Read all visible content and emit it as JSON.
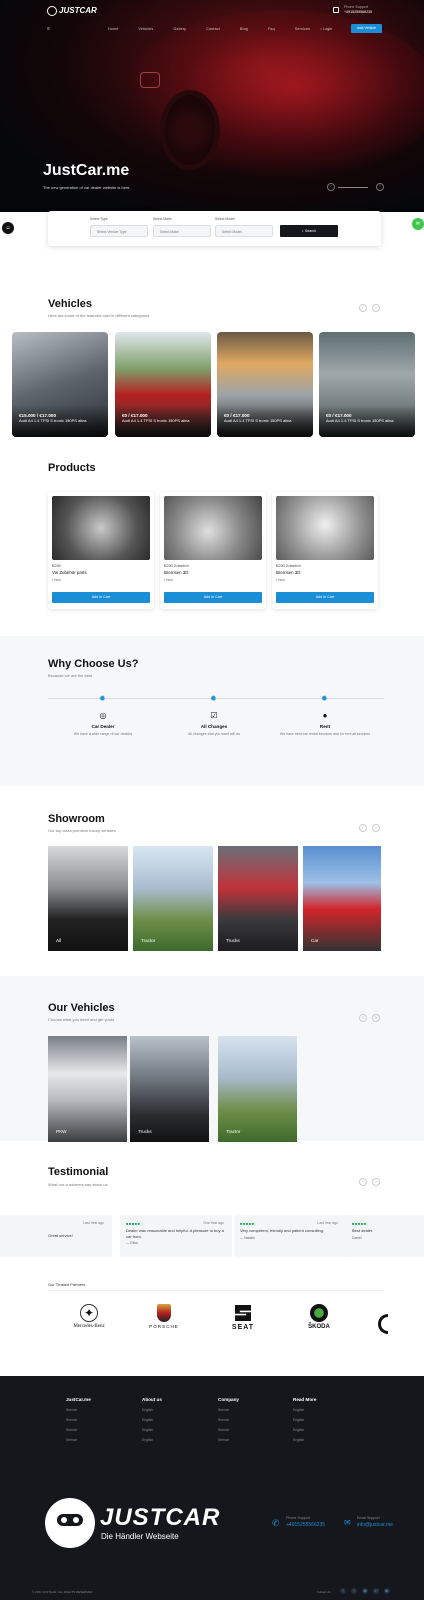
{
  "header": {
    "brand": "JUSTCAR",
    "phone_label": "Phone Support",
    "phone": "+4915255566235",
    "nav": [
      "Home",
      "Vehicles",
      "Gallery",
      "Contact",
      "Blog",
      "Faq",
      "Services"
    ],
    "login": "Login",
    "cta": "Add Vehicle"
  },
  "hero": {
    "title": "JustCar.me",
    "subtitle": "The new generation of car dealer website is here."
  },
  "search": {
    "f1_label": "Select Type",
    "f1": "Select Vehicle Type",
    "f2_label": "Select Make",
    "f2": "Select Make",
    "f3_label": "Select Model",
    "f3": "Select Model",
    "button": "Search"
  },
  "vehicles": {
    "title": "Vehicles",
    "subtitle": "Here are some of the featured cars in different categories",
    "items": [
      {
        "price": "€15.000 / €17.000",
        "name": "Audi A4 1.4 TFSI S tronic 150PS alina"
      },
      {
        "price": "€0 / €17.000",
        "name": "Audi A4 1.4 TFSI S tronic 150PS alina"
      },
      {
        "price": "€0 / €17.000",
        "name": "Audi A4 1.4 TFSI S tronic 150PS alina"
      },
      {
        "price": "€0 / €17.000",
        "name": "Audi A4 1.4 TFSI S tronic 150PS alina"
      }
    ]
  },
  "products": {
    "title": "Products",
    "items": [
      {
        "price": "€250",
        "name": "Vw Zubehör parts",
        "stock": "Neu",
        "button": "Add to Cart"
      },
      {
        "price": "€250 Zubehör",
        "name": "Bremsen 3D",
        "stock": "Neu",
        "button": "Add to Cart"
      },
      {
        "price": "€250 Zubehör",
        "name": "Bremsen 3D",
        "stock": "Neu",
        "button": "Add to Cart"
      }
    ]
  },
  "why": {
    "title": "Why Choose Us?",
    "subtitle": "Because we are the best",
    "features": [
      {
        "title": "Car Dealer",
        "desc": "We have a wide range of car dealers"
      },
      {
        "title": "All Changes",
        "desc": "All changes that you want will do"
      },
      {
        "title": "Rent",
        "desc": "We have best car rental services and for rent all services"
      }
    ]
  },
  "showroom": {
    "title": "Showroom",
    "subtitle": "Our top class premium luxury vehicles",
    "items": [
      "All",
      "Tractor",
      "Trucks",
      "Car"
    ]
  },
  "our_vehicles": {
    "title": "Our Vehicles",
    "subtitle": "Choose what you need and get yours",
    "items": [
      "PKW",
      "Trucks",
      "Tractor"
    ]
  },
  "testimonial": {
    "title": "Testimonial",
    "subtitle": "What our customers say about us",
    "items": [
      {
        "date": "Last Year ago",
        "quote": "Great service!",
        "author": ""
      },
      {
        "date": "One Year ago",
        "quote": "Dealer was reasonable and helpful. A pleasure to buy a car from.",
        "author": "Elisa"
      },
      {
        "date": "Last Year ago",
        "quote": "Very competent, friendly and patient consulting.",
        "author": "Natalie"
      },
      {
        "date": "",
        "quote": "Best dealer.",
        "author": "Daniel"
      }
    ]
  },
  "partners": {
    "title": "Our Trusted Partners",
    "brands": [
      "Mercedes-Benz",
      "PORSCHE",
      "SEAT",
      "ŠKODA"
    ]
  },
  "footer": {
    "cols": [
      {
        "h": "JustCar.me",
        "items": [
          "Service",
          "Service",
          "Service",
          "Service"
        ]
      },
      {
        "h": "About us",
        "items": [
          "English",
          "English",
          "English",
          "English"
        ]
      },
      {
        "h": "Company",
        "items": [
          "Service",
          "Service",
          "Service",
          "Service"
        ]
      },
      {
        "h": "Read More",
        "items": [
          "English",
          "English",
          "English",
          "English"
        ]
      }
    ],
    "logo": "JUSTCAR",
    "tagline": "Die Händler Webseite",
    "phone_label": "Phone Support",
    "phone": "+4915255566235",
    "email_label": "Email Support",
    "email": "info@justcar.me",
    "copyright": "© 2024 JUSTCAR. ALL RIGHTS RESERVED",
    "follow": "Follow Us:"
  },
  "colors": {
    "accent": "#1a8fd8",
    "dark": "#15171d",
    "green": "#1fb25a"
  }
}
